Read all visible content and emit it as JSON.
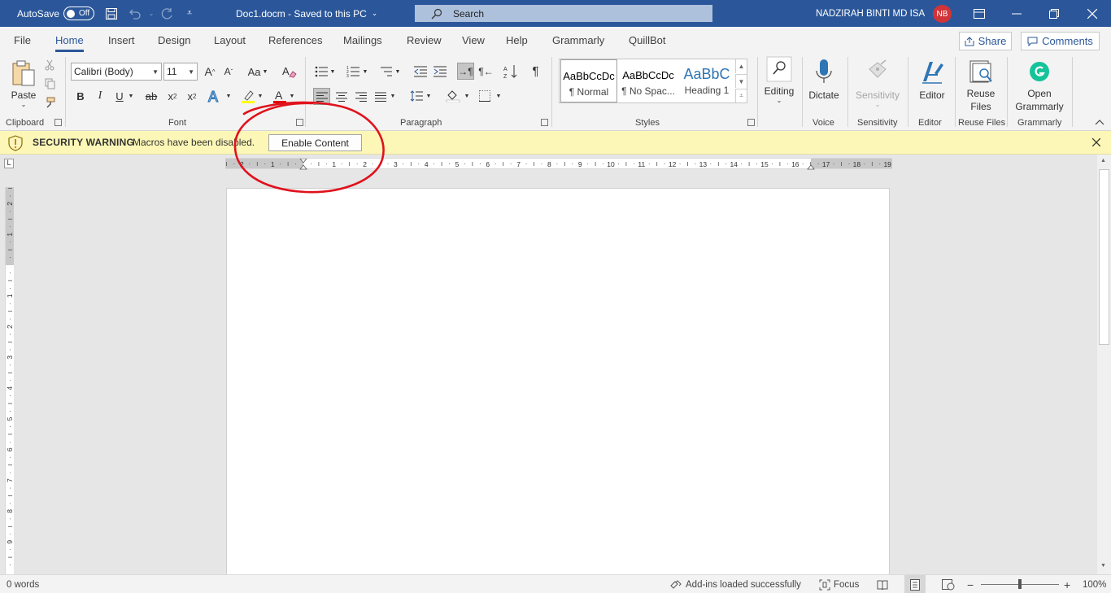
{
  "titlebar": {
    "autosave_label": "AutoSave",
    "autosave_state": "Off",
    "doc_title": "Doc1.docm  -  Saved to this PC",
    "doc_title_caret": "⌄",
    "search_placeholder": "Search",
    "user_name": "NADZIRAH BINTI MD ISA",
    "user_initials": "NB"
  },
  "tabs": [
    "File",
    "Home",
    "Insert",
    "Design",
    "Layout",
    "References",
    "Mailings",
    "Review",
    "View",
    "Help",
    "Grammarly",
    "QuillBot"
  ],
  "active_tab": "Home",
  "share_label": "Share",
  "comments_label": "Comments",
  "ribbon": {
    "clipboard": {
      "paste_label": "Paste",
      "group_label": "Clipboard"
    },
    "font": {
      "font_name": "Calibri (Body)",
      "font_size": "11",
      "change_case": "Aa",
      "bold": "B",
      "italic": "I",
      "underline": "U",
      "strike": "ab",
      "subscript": "x",
      "superscript": "x",
      "grow": "A",
      "shrink": "A",
      "color_a": "A",
      "group_label": "Font"
    },
    "paragraph": {
      "group_label": "Paragraph"
    },
    "styles": {
      "items": [
        {
          "sample": "AaBbCcDc",
          "name": "¶ Normal"
        },
        {
          "sample": "AaBbCcDc",
          "name": "¶ No Spac..."
        },
        {
          "sample": "AaBbC",
          "name": "Heading 1"
        }
      ],
      "group_label": "Styles"
    },
    "editing_label": "Editing",
    "dictate_label": "Dictate",
    "voice_group": "Voice",
    "sensitivity_label": "Sensitivity",
    "sensitivity_group": "Sensitivity",
    "editor_label": "Editor",
    "editor_group": "Editor",
    "reuse_label_1": "Reuse",
    "reuse_label_2": "Files",
    "reuse_group": "Reuse Files",
    "grammarly_label_1": "Open",
    "grammarly_label_2": "Grammarly",
    "grammarly_group": "Grammarly"
  },
  "security_bar": {
    "title": "SECURITY WARNING",
    "message": "Macros have been disabled.",
    "button": "Enable Content"
  },
  "rulers": {
    "h_labels": [
      "2",
      "1",
      "1",
      "2",
      "3",
      "4",
      "5",
      "6",
      "7",
      "8",
      "9",
      "10",
      "11",
      "12",
      "13",
      "14",
      "15",
      "16",
      "17",
      "18",
      "19"
    ],
    "v_labels": [
      "2",
      "1",
      "1",
      "2",
      "3",
      "4",
      "5",
      "6",
      "7",
      "8",
      "9"
    ]
  },
  "statusbar": {
    "word_count": "0 words",
    "addins": "Add-ins loaded successfully",
    "focus": "Focus",
    "zoom": "100%",
    "zoom_minus": "−",
    "zoom_plus": "+"
  },
  "colors": {
    "brand": "#2b579a",
    "warning_bg": "#fcf7b6",
    "annotation": "#e0121d",
    "avatar": "#d13438",
    "grammarly": "#15c39a"
  }
}
